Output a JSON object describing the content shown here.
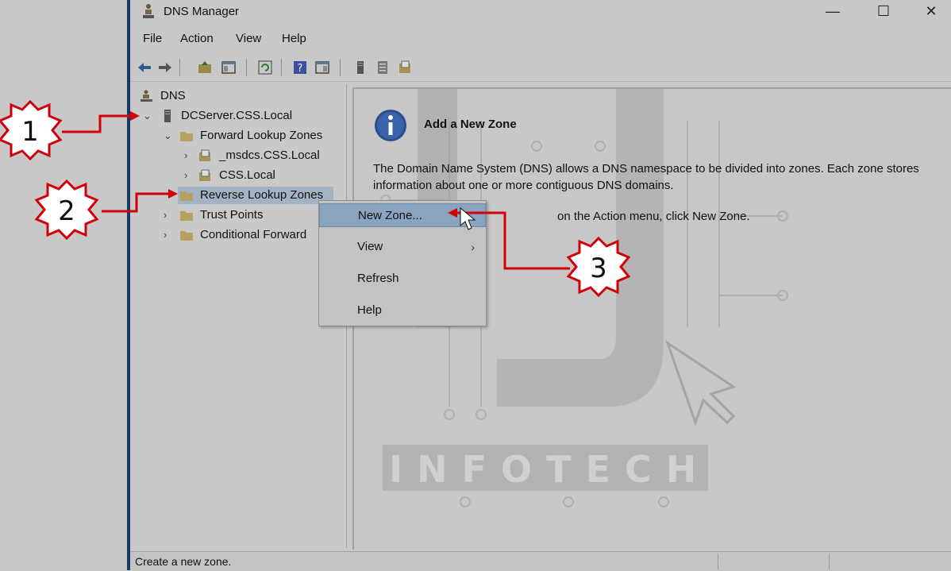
{
  "window": {
    "title": "DNS Manager",
    "controls": [
      "—",
      "☐",
      "✕"
    ]
  },
  "menu": [
    "File",
    "Action",
    "View",
    "Help"
  ],
  "toolbar": {
    "icons": [
      "back-arrow-icon",
      "forward-arrow-icon",
      "up-folder-icon",
      "show-hide-console-tree-icon",
      "refresh-icon",
      "help-icon",
      "action-pane-icon",
      "server-icon",
      "list-icon",
      "zone-icon"
    ]
  },
  "tree": {
    "root": "DNS",
    "server": "DCServer.CSS.Local",
    "items": [
      {
        "label": "Forward Lookup Zones"
      },
      {
        "label": "_msdcs.CSS.Local"
      },
      {
        "label": "CSS.Local"
      },
      {
        "label": "Reverse Lookup Zones"
      },
      {
        "label": "Trust Points"
      },
      {
        "label": "Conditional Forward"
      }
    ]
  },
  "content": {
    "heading": "Add a New Zone",
    "description": "The Domain Name System (DNS) allows a DNS namespace to be divided into zones. Each zone stores information about one or more contiguous DNS domains.",
    "instruction": "on the Action menu, click New Zone."
  },
  "context_menu": {
    "items": [
      {
        "label": "New Zone...",
        "highlighted": true
      },
      {
        "label": "View",
        "submenu": "›"
      },
      {
        "label": "Refresh"
      },
      {
        "label": "Help"
      }
    ]
  },
  "status": {
    "text": "Create a new zone."
  },
  "annotations": {
    "badges": [
      "1",
      "2",
      "3"
    ],
    "color": "#d0000a"
  },
  "watermark": {
    "text": "INFOTECH"
  }
}
